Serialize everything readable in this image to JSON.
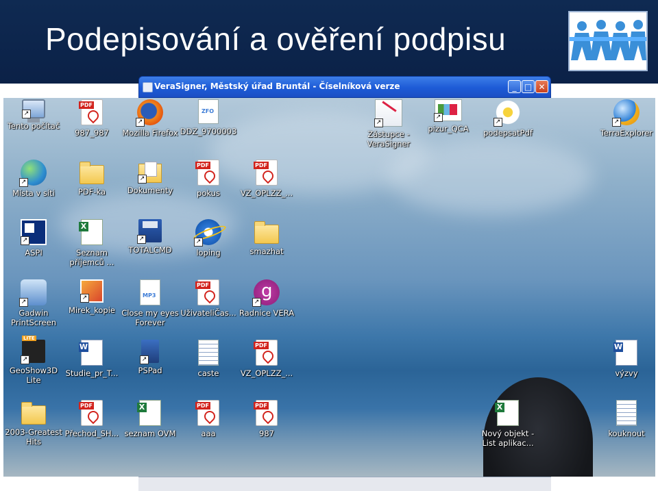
{
  "slide": {
    "title": "Podepisování a ověření podpisu"
  },
  "window": {
    "title": "VeraSigner, Městský úřad Bruntál - Číselníková verze",
    "minimize": "_",
    "maximize": "□",
    "close": "✕"
  },
  "desktop_icons": [
    {
      "label": "Tento počítač",
      "icon": "computer-icon"
    },
    {
      "label": "987_987",
      "icon": "pdf-icon"
    },
    {
      "label": "Mozilla Firefox",
      "icon": "firefox-icon"
    },
    {
      "label": "DDZ_9700003",
      "icon": "zfo-document-icon"
    },
    {
      "label": "Zástupce - VeraSigner",
      "icon": "signature-icon"
    },
    {
      "label": "pizur_QCA",
      "icon": "certificate-icon"
    },
    {
      "label": "podepsatPdf",
      "icon": "daisy-icon"
    },
    {
      "label": "TerraExplorer",
      "icon": "globe-icon"
    },
    {
      "label": "Místa v síti",
      "icon": "network-globe-icon"
    },
    {
      "label": "PDF-ka",
      "icon": "folder-icon"
    },
    {
      "label": "Dokumenty",
      "icon": "documents-folder-icon"
    },
    {
      "label": "pokus",
      "icon": "pdf-icon"
    },
    {
      "label": "VZ_OPLZZ_...",
      "icon": "pdf-icon"
    },
    {
      "label": "ASPI",
      "icon": "aspi-icon"
    },
    {
      "label": "Seznam příjemců ...",
      "icon": "excel-icon"
    },
    {
      "label": "TOTALCMD",
      "icon": "floppy-icon"
    },
    {
      "label": "loping",
      "icon": "internet-explorer-icon"
    },
    {
      "label": "smazhat",
      "icon": "folder-icon"
    },
    {
      "label": "Gadwin PrintScreen",
      "icon": "camera-icon"
    },
    {
      "label": "Mirek_kopie",
      "icon": "image-icon"
    },
    {
      "label": "Close my eyes Forever",
      "icon": "mp3-icon"
    },
    {
      "label": "UživateliČas...",
      "icon": "pdf-icon"
    },
    {
      "label": "Radnice VERA",
      "icon": "vera-icon"
    },
    {
      "label": "GeoShow3D Lite",
      "icon": "geoshow-icon"
    },
    {
      "label": "Studie_pr_T...",
      "icon": "word-icon"
    },
    {
      "label": "PSPad",
      "icon": "pspad-icon"
    },
    {
      "label": "caste",
      "icon": "notepad-icon"
    },
    {
      "label": "VZ_OPLZZ_...",
      "icon": "pdf-icon"
    },
    {
      "label": "výzvy",
      "icon": "word-icon"
    },
    {
      "label": "2003-Greatest Hits",
      "icon": "folder-icon"
    },
    {
      "label": "Přechod_SH...",
      "icon": "pdf-icon"
    },
    {
      "label": "seznam OVM",
      "icon": "excel-icon"
    },
    {
      "label": "aaa",
      "icon": "pdf-icon"
    },
    {
      "label": "987",
      "icon": "pdf-icon"
    },
    {
      "label": "Nový objekt - List aplikac...",
      "icon": "excel-icon"
    },
    {
      "label": "kouknout",
      "icon": "notepad-icon"
    }
  ]
}
